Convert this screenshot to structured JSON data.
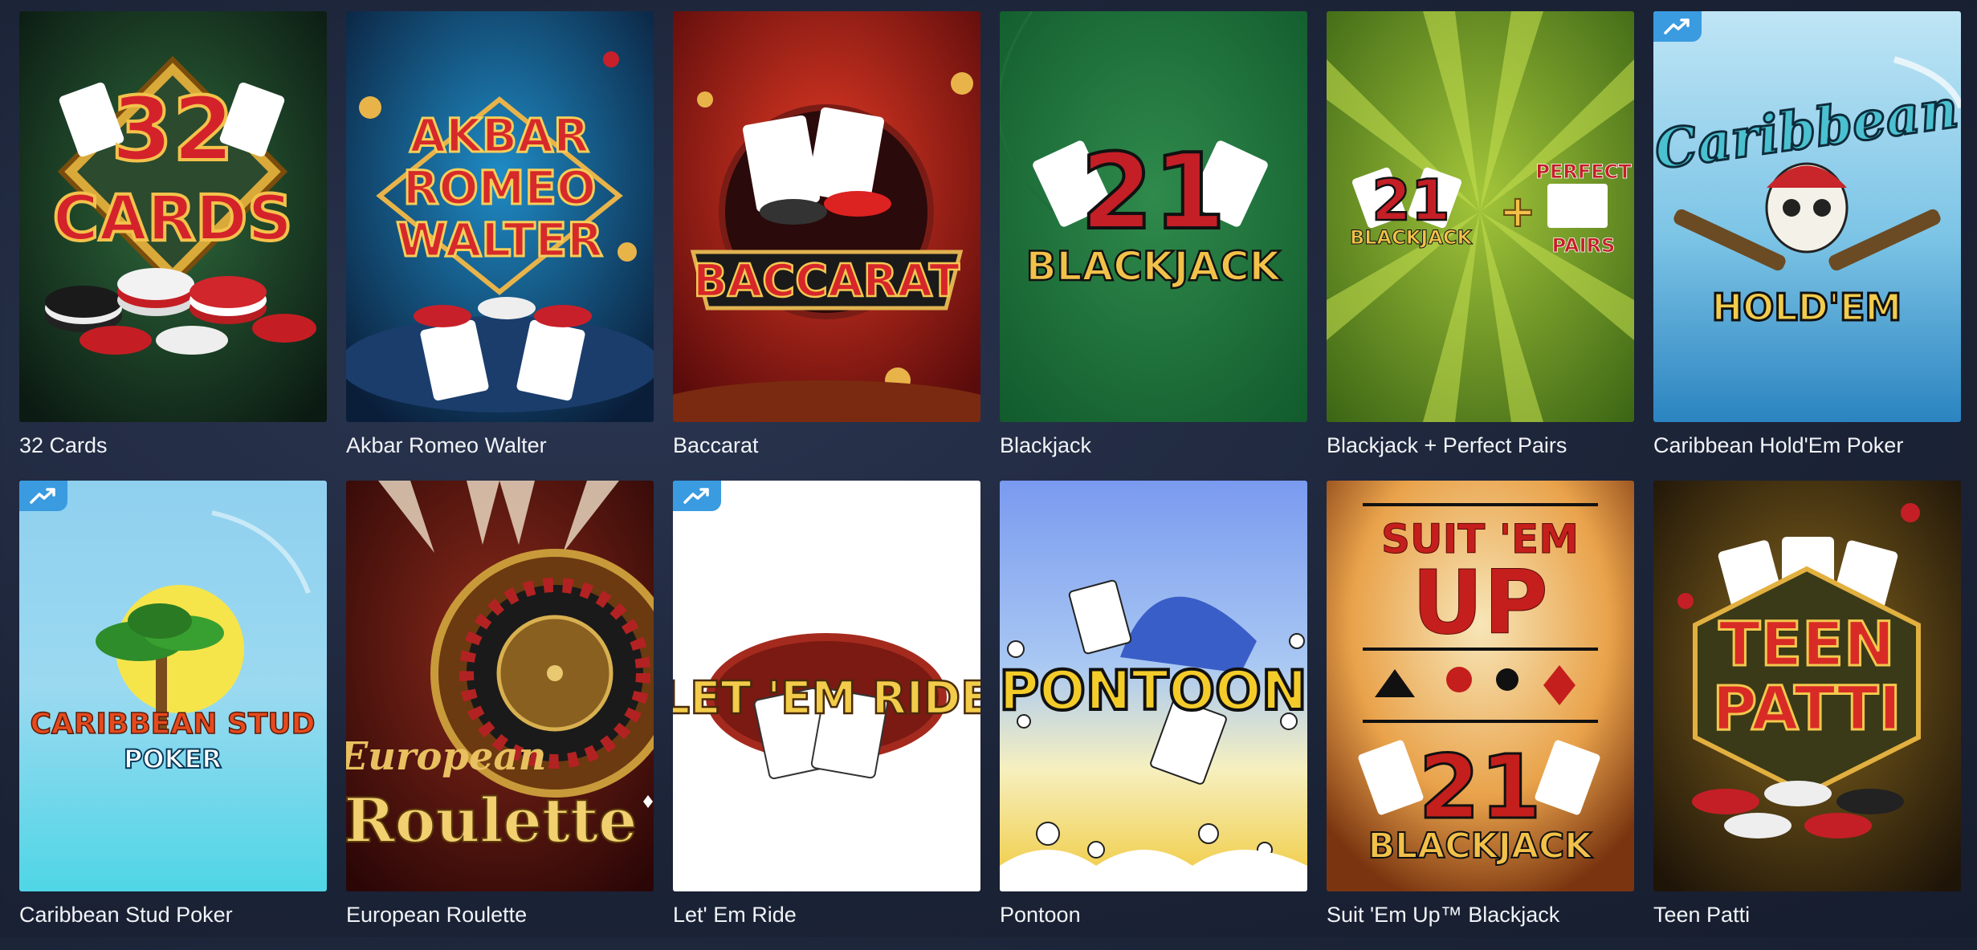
{
  "games": [
    {
      "title": "32 Cards",
      "logo_lines": [
        "32",
        "CARDS"
      ],
      "trending": false
    },
    {
      "title": "Akbar Romeo Walter",
      "logo_lines": [
        "AKBAR",
        "ROMEO",
        "WALTER"
      ],
      "trending": false
    },
    {
      "title": "Baccarat",
      "logo_lines": [
        "BACCARAT"
      ],
      "trending": false
    },
    {
      "title": "Blackjack",
      "logo_lines": [
        "21",
        "BLACKJACK"
      ],
      "trending": false
    },
    {
      "title": "Blackjack + Perfect Pairs",
      "logo_lines": [
        "21",
        "BLACKJACK",
        "+",
        "PERFECT",
        "PAIRS"
      ],
      "trending": false
    },
    {
      "title": "Caribbean Hold'Em Poker",
      "logo_lines": [
        "Caribbean",
        "HOLD'EM"
      ],
      "trending": true
    },
    {
      "title": "Caribbean Stud Poker",
      "logo_lines": [
        "CARIBBEAN STUD",
        "POKER"
      ],
      "trending": true
    },
    {
      "title": "European Roulette",
      "logo_lines": [
        "European",
        "Roulette"
      ],
      "trending": false
    },
    {
      "title": "Let' Em Ride",
      "logo_lines": [
        "LET 'EM RIDE"
      ],
      "trending": true
    },
    {
      "title": "Pontoon",
      "logo_lines": [
        "PONTOON"
      ],
      "trending": false
    },
    {
      "title": "Suit 'Em Up™ Blackjack",
      "logo_lines": [
        "SUIT 'EM",
        "UP",
        "21",
        "BLACKJACK"
      ],
      "trending": false
    },
    {
      "title": "Teen Patti",
      "logo_lines": [
        "TEEN",
        "PATTI"
      ],
      "trending": false
    }
  ],
  "icons": {
    "trending": "trending-up-icon"
  },
  "colors": {
    "badge": "#3a9be0",
    "caption": "#f1f3f7",
    "background": "#1c2438"
  }
}
